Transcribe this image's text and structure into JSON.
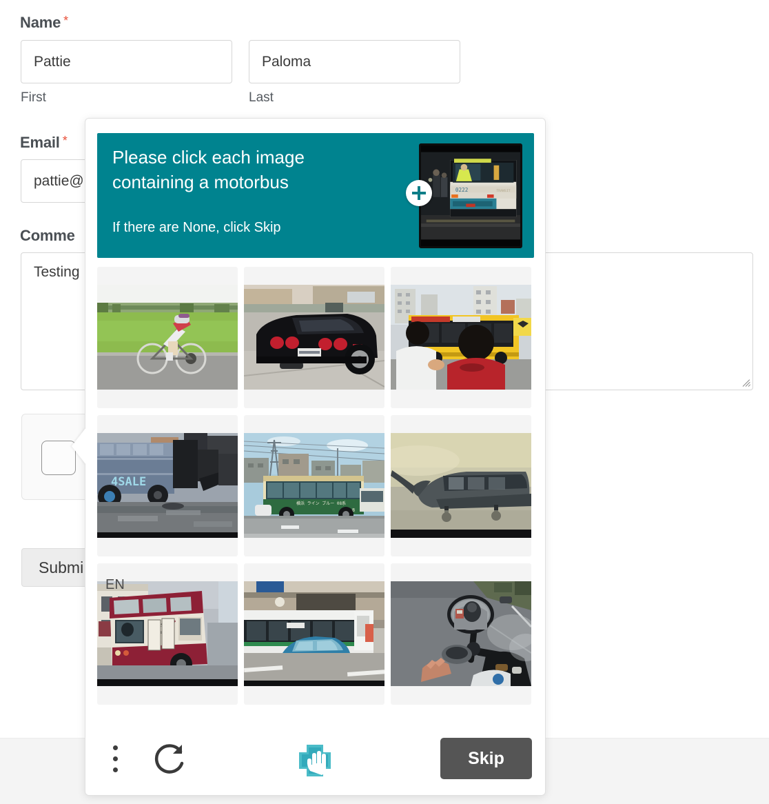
{
  "form": {
    "name": {
      "label": "Name",
      "required_mark": "*",
      "first": {
        "value": "Pattie",
        "sub_label": "First"
      },
      "last": {
        "value": "Paloma",
        "sub_label": "Last"
      }
    },
    "email": {
      "label": "Email",
      "required_mark": "*",
      "value": "pattie@"
    },
    "comment": {
      "label": "Comme",
      "value": "Testing"
    },
    "submit_label": "Submi"
  },
  "captcha": {
    "prompt": "Please click each image containing a motorbus",
    "prompt_sub": "If there are None, click Skip",
    "target_object": "motorbus",
    "example_label": "example-image-motorbus",
    "expand_icon": "plus-icon",
    "language": "EN",
    "menu_icon": "kebab-menu-icon",
    "refresh_icon": "refresh-icon",
    "logo_icon": "hcaptcha-hand-logo",
    "skip_label": "Skip",
    "accent_color": "#00838f",
    "skip_button_color": "#555555",
    "grid_rows": 3,
    "grid_cols": 3,
    "tiles": [
      {
        "id": 1,
        "alt": "cyclist riding bicycle on road beside green field",
        "selected": false
      },
      {
        "id": 2,
        "alt": "black sports car rear view on driveway",
        "selected": false
      },
      {
        "id": 3,
        "alt": "two men watching a yellow city bus on street",
        "selected": false
      },
      {
        "id": 4,
        "alt": "blue truck with 4SALE painted on side in muddy lot",
        "selected": false
      },
      {
        "id": 5,
        "alt": "green and cream Japanese city bus on road",
        "selected": false
      },
      {
        "id": 6,
        "alt": "small propeller airplane on hazy ground",
        "selected": false
      },
      {
        "id": 7,
        "alt": "red and cream double decker bus in town",
        "selected": false
      },
      {
        "id": 8,
        "alt": "white bus behind blue sedan car on street",
        "selected": false
      },
      {
        "id": 9,
        "alt": "motorcycle rider point of view with mirror",
        "selected": false
      }
    ]
  }
}
